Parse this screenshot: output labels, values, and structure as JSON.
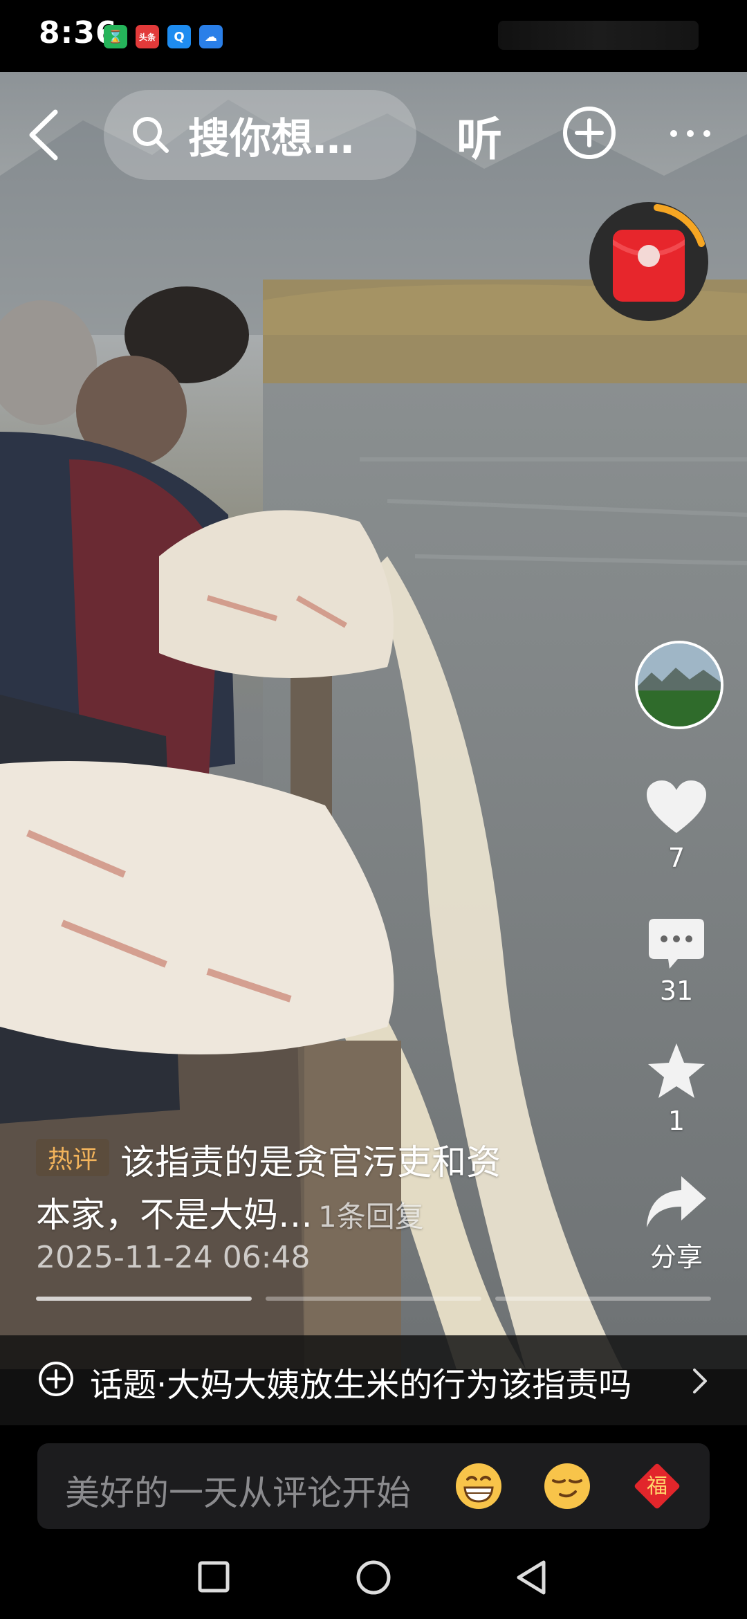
{
  "status_bar": {
    "time": "8:36",
    "apps": [
      {
        "name": "hourglass-app-icon",
        "glyph": "⌛",
        "color": "#25b45a"
      },
      {
        "name": "toutiao-app-icon",
        "glyph": "头条",
        "color": "#e23a3a"
      },
      {
        "name": "search-app-icon",
        "glyph": "Q",
        "color": "#1e8cf0"
      },
      {
        "name": "weather-app-icon",
        "glyph": "☁",
        "color": "#2a7fe8"
      }
    ]
  },
  "top_bar": {
    "search_text": "搜你想…",
    "listen_label": "听"
  },
  "right_rail": {
    "likes": "7",
    "comments": "31",
    "favorites": "1",
    "share_label": "分享"
  },
  "hot_comment": {
    "badge": "热评",
    "line1": "该指责的是贪官污吏和资",
    "line2": "本家，不是大妈…",
    "reply": "1条回复",
    "time": "2025-11-24 06:48"
  },
  "topic": {
    "label": "话题·大妈大姨放生米的行为该指责吗"
  },
  "input": {
    "placeholder": "美好的一天从评论开始"
  },
  "colors": {
    "accent_red": "#e7262c",
    "badge_orange": "#f2b35b",
    "countdown_ring": "#f6a623"
  }
}
